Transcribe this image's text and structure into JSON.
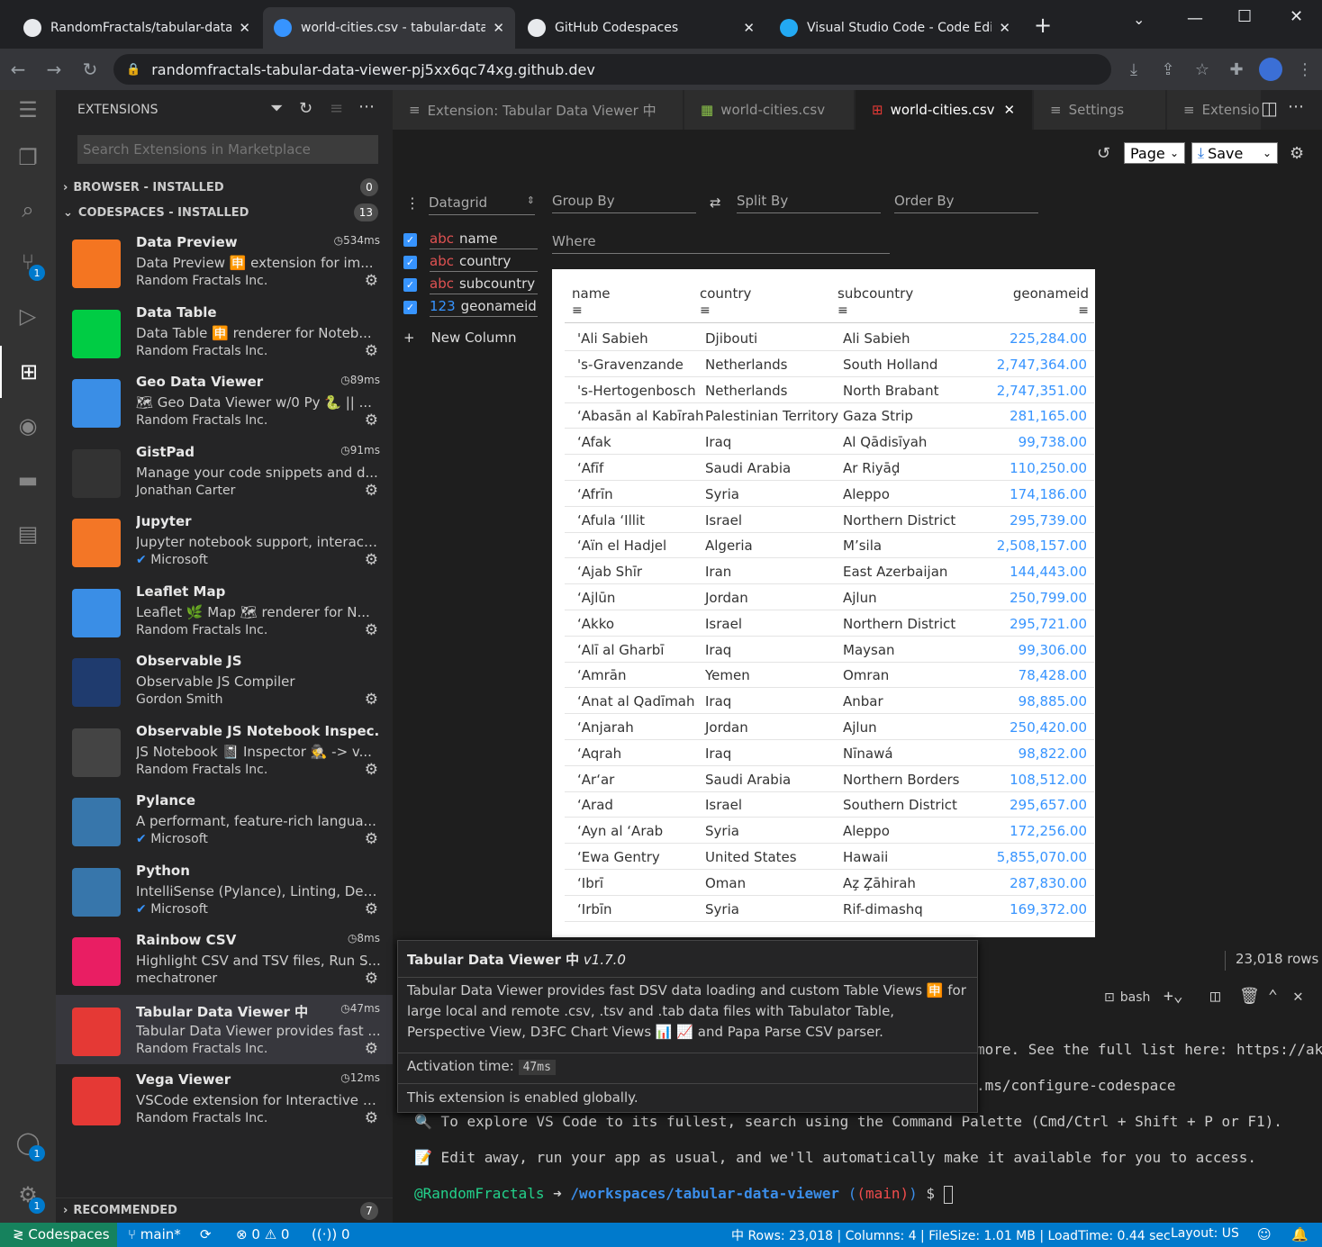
{
  "browser": {
    "tabs": [
      {
        "title": "RandomFractals/tabular-data-",
        "close": "✕"
      },
      {
        "title": "world-cities.csv - tabular-data",
        "close": "✕"
      },
      {
        "title": "GitHub Codespaces",
        "close": "✕"
      },
      {
        "title": "Visual Studio Code - Code Edi",
        "close": "✕"
      }
    ],
    "url": "randomfractals-tabular-data-viewer-pj5xx6qc74xg.github.dev"
  },
  "activity": {
    "scm_badge": "1",
    "accounts_badge": "1",
    "settings_badge": "1"
  },
  "sidebar": {
    "title": "EXTENSIONS",
    "search_placeholder": "Search Extensions in Marketplace",
    "browser_section": "BROWSER - INSTALLED",
    "browser_count": "0",
    "codespaces_section": "CODESPACES - INSTALLED",
    "codespaces_count": "13",
    "recommended_section": "RECOMMENDED",
    "recommended_count": "7",
    "extensions": [
      {
        "name": "Data Preview",
        "desc": "Data Preview 🈸 extension for im...",
        "publisher": "Random Fractals Inc.",
        "time": "534ms",
        "icon": "data-preview-icon",
        "color": "#f47521"
      },
      {
        "name": "Data Table",
        "desc": "Data Table 🈸 renderer for Noteb...",
        "publisher": "Random Fractals Inc.",
        "time": "",
        "icon": "data-table-icon",
        "color": "#00cc44"
      },
      {
        "name": "Geo Data Viewer",
        "desc": "🗺 Geo Data Viewer w/0 Py 🐍 || ...",
        "publisher": "Random Fractals Inc.",
        "time": "89ms",
        "icon": "map-icon",
        "color": "#3a8ee6"
      },
      {
        "name": "GistPad",
        "desc": "Manage your code snippets and d...",
        "publisher": "Jonathan Carter",
        "time": "91ms",
        "icon": "notebook-icon",
        "color": "#333"
      },
      {
        "name": "Jupyter",
        "desc": "Jupyter notebook support, interact...",
        "publisher": "Microsoft",
        "time": "",
        "icon": "jupyter-icon",
        "color": "#f37626"
      },
      {
        "name": "Leaflet Map",
        "desc": "Leaflet 🌿 Map 🗺 renderer for N...",
        "publisher": "Random Fractals Inc.",
        "time": "",
        "icon": "leaflet-map-icon",
        "color": "#3a8ee6"
      },
      {
        "name": "Observable JS",
        "desc": "Observable JS Compiler",
        "publisher": "Gordon Smith",
        "time": "",
        "icon": "observable-icon",
        "color": "#1f3b6e"
      },
      {
        "name": "Observable JS Notebook Inspec...",
        "desc": "JS Notebook 📓 Inspector 🕵 -> v...",
        "publisher": "Random Fractals Inc.",
        "time": "",
        "icon": "notebook-inspector-icon",
        "color": "#444"
      },
      {
        "name": "Pylance",
        "desc": "A performant, feature-rich langua...",
        "publisher": "Microsoft",
        "time": "",
        "icon": "python-icon",
        "color": "#3776ab"
      },
      {
        "name": "Python",
        "desc": "IntelliSense (Pylance), Linting, Deb...",
        "publisher": "Microsoft",
        "time": "",
        "icon": "python-icon",
        "color": "#3776ab"
      },
      {
        "name": "Rainbow CSV",
        "desc": "Highlight CSV and TSV files, Run S...",
        "publisher": "mechatroner",
        "time": "8ms",
        "icon": "csv-icon",
        "color": "#e91e63"
      },
      {
        "name": "Tabular Data Viewer 中",
        "desc": "Tabular Data Viewer provides fast ...",
        "publisher": "Random Fractals Inc.",
        "time": "47ms",
        "icon": "tabular-icon",
        "color": "#e53935"
      },
      {
        "name": "Vega Viewer",
        "desc": "VSCode extension for Interactive P...",
        "publisher": "Random Fractals Inc.",
        "time": "12ms",
        "icon": "chart-icon",
        "color": "#e53935"
      }
    ]
  },
  "editor_tabs": [
    {
      "label": "Extension: Tabular Data Viewer 中"
    },
    {
      "label": "world-cities.csv"
    },
    {
      "label": "world-cities.csv"
    },
    {
      "label": "Settings"
    },
    {
      "label": "Extensio"
    }
  ],
  "toolbar": {
    "page_select": "Page",
    "save_select": "Save"
  },
  "controls": {
    "view": "Datagrid",
    "group_by": "Group By",
    "split_by": "Split By",
    "order_by": "Order By",
    "where": "Where",
    "new_column": "New Column",
    "columns": [
      {
        "type": "abc",
        "name": "name"
      },
      {
        "type": "abc",
        "name": "country"
      },
      {
        "type": "abc",
        "name": "subcountry"
      },
      {
        "type": "123",
        "name": "geonameid"
      }
    ]
  },
  "grid": {
    "headers": [
      "name",
      "country",
      "subcountry",
      "geonameid"
    ],
    "rows": [
      [
        "'Ali Sabieh",
        "Djibouti",
        "Ali Sabieh",
        "225,284.00"
      ],
      [
        "'s-Gravenzande",
        "Netherlands",
        "South Holland",
        "2,747,364.00"
      ],
      [
        "'s-Hertogenbosch",
        "Netherlands",
        "North Brabant",
        "2,747,351.00"
      ],
      [
        "‘Abasān al Kabīrah",
        "Palestinian Territory",
        "Gaza Strip",
        "281,165.00"
      ],
      [
        "‘Afak",
        "Iraq",
        "Al Qādisīyah",
        "99,738.00"
      ],
      [
        "‘Afīf",
        "Saudi Arabia",
        "Ar Riyāḑ",
        "110,250.00"
      ],
      [
        "‘Afrīn",
        "Syria",
        "Aleppo",
        "174,186.00"
      ],
      [
        "‘Afula ‘Illit",
        "Israel",
        "Northern District",
        "295,739.00"
      ],
      [
        "‘Aïn el Hadjel",
        "Algeria",
        "M’sila",
        "2,508,157.00"
      ],
      [
        "‘Ajab Shīr",
        "Iran",
        "East Azerbaijan",
        "144,443.00"
      ],
      [
        "‘Ajlūn",
        "Jordan",
        "Ajlun",
        "250,799.00"
      ],
      [
        "‘Akko",
        "Israel",
        "Northern District",
        "295,721.00"
      ],
      [
        "‘Alī al Gharbī",
        "Iraq",
        "Maysan",
        "99,306.00"
      ],
      [
        "‘Amrān",
        "Yemen",
        "Omran",
        "78,428.00"
      ],
      [
        "‘Anat al Qadīmah",
        "Iraq",
        "Anbar",
        "98,885.00"
      ],
      [
        "‘Anjarah",
        "Jordan",
        "Ajlun",
        "250,420.00"
      ],
      [
        "‘Aqrah",
        "Iraq",
        "Nīnawá",
        "98,822.00"
      ],
      [
        "‘Ar‘ar",
        "Saudi Arabia",
        "Northern Borders",
        "108,512.00"
      ],
      [
        "‘Arad",
        "Israel",
        "Southern District",
        "295,657.00"
      ],
      [
        "‘Ayn al ‘Arab",
        "Syria",
        "Aleppo",
        "172,256.00"
      ],
      [
        "‘Ewa Gentry",
        "United States",
        "Hawaii",
        "5,855,070.00"
      ],
      [
        "‘Ibrī",
        "Oman",
        "Az̧ Z̧āhirah",
        "287,830.00"
      ],
      [
        "‘Irbīn",
        "Syria",
        "Rif-dimashq",
        "169,372.00"
      ]
    ]
  },
  "row_count": "23,018 rows",
  "terminal": {
    "shell": "bash",
    "line1": "more. See the full list here: https://ak",
    "line2": ".ms/configure-codespace",
    "line3": "🔍 To explore VS Code to its fullest, search using the Command Palette (Cmd/Ctrl + Shift + P or F1).",
    "line4": "📝 Edit away, run your app as usual, and we'll automatically make it available for you to access.",
    "prompt_user": "@RandomFractals",
    "prompt_path": "/workspaces/tabular-data-viewer",
    "prompt_branch": "(main)",
    "prompt_symbol": "$"
  },
  "tooltip": {
    "title": "Tabular Data Viewer 中",
    "version": "v1.7.0",
    "desc": "Tabular Data Viewer provides fast DSV data loading and custom Table Views 🈸 for large local and remote .csv, .tsv and .tab data files with Tabulator Table, Perspective View, D3FC Chart Views 📊 📈 and Papa Parse CSV parser.",
    "activation_label": "Activation time:",
    "activation_value": "47ms",
    "enabled": "This extension is enabled globally."
  },
  "statusbar": {
    "remote": "Codespaces",
    "branch": "main*",
    "errors": "0",
    "warnings": "0",
    "ports": "0",
    "info": "中 Rows: 23,018 | Columns: 4 | FileSize: 1.01 MB | LoadTime: 0.44 sec",
    "layout": "Layout: US"
  },
  "colors": {
    "accent": "#007acc",
    "number": "#3794ff"
  }
}
